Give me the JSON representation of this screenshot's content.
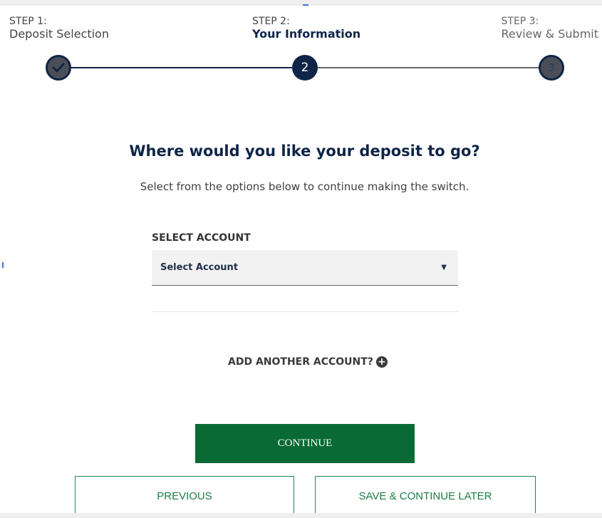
{
  "stepper": {
    "steps": [
      {
        "number_label": "STEP 1:",
        "title": "Deposit Selection",
        "state": "complete",
        "circle_text": ""
      },
      {
        "number_label": "STEP 2:",
        "title": "Your Information",
        "state": "current",
        "circle_text": "2"
      },
      {
        "number_label": "STEP 3:",
        "title": "Review & Submit",
        "state": "upcoming",
        "circle_text": "3"
      }
    ]
  },
  "main": {
    "heading": "Where would you like your deposit to go?",
    "subheading": "Select from the options below to continue making the switch.",
    "account_field": {
      "label": "SELECT ACCOUNT",
      "selected_value": "Select Account"
    },
    "add_account_label": "ADD ANOTHER ACCOUNT?"
  },
  "actions": {
    "continue_label": "CONTINUE",
    "previous_label": "PREVIOUS",
    "save_later_label": "SAVE & CONTINUE LATER"
  },
  "colors": {
    "primary_navy": "#0f2547",
    "primary_green": "#0a6a35",
    "outline_green": "#1f8a4c"
  }
}
